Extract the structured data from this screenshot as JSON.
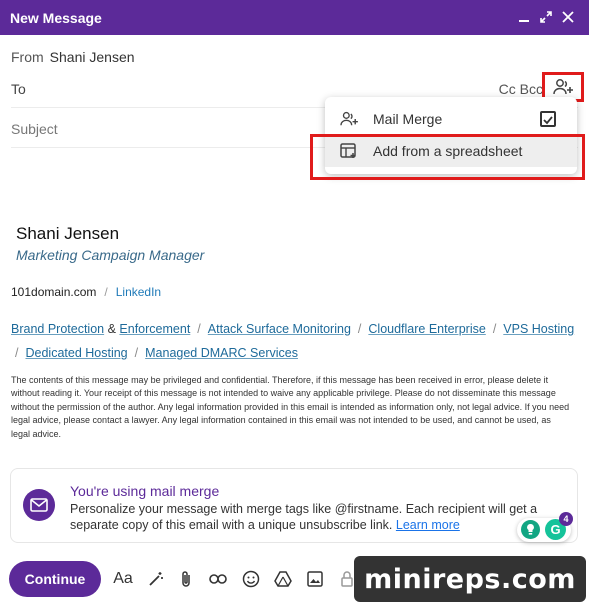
{
  "window": {
    "title": "New Message",
    "controls": [
      "minimize-icon",
      "expand-icon",
      "close-icon"
    ]
  },
  "from": {
    "label": "From",
    "value": "Shani Jensen"
  },
  "to": {
    "label": "To",
    "cc_bcc": "Cc Bcc"
  },
  "subject": {
    "placeholder": "Subject"
  },
  "dropdown": {
    "items": [
      {
        "label": "Mail Merge",
        "icon": "people-add-icon",
        "checked": true
      },
      {
        "label": "Add from a spreadsheet",
        "icon": "spreadsheet-icon"
      }
    ]
  },
  "signature": {
    "name": "Shani Jensen",
    "title": "Marketing Campaign Manager",
    "domain": "101domain.com",
    "separator": "/",
    "linkedin": "LinkedIn",
    "services_line1": [
      "Brand Protection",
      "Enforcement",
      "Attack Surface Monitoring",
      "Cloudflare Enterprise",
      "VPS Hosting"
    ],
    "amp": "&",
    "services_line2": [
      "Dedicated Hosting",
      "Managed DMARC Services"
    ],
    "disclaimer": "The contents of this message may be privileged and confidential. Therefore, if this message has been received in error, please delete it without reading it. Your receipt of this message is not intended to waive any applicable privilege. Please do not disseminate this message without the permission of the author. Any legal information provided in this email is intended as information only, not legal advice. If you need legal advice, please contact a lawyer. Any legal information contained in this email was not intended to be used, and cannot be used, as legal advice."
  },
  "mail_merge_card": {
    "heading": "You're using mail merge",
    "text": "Personalize your message with merge tags like @firstname. Each recipient will get a separate copy of this email with a unique unsubscribe link.",
    "link": "Learn more"
  },
  "grammarly": {
    "badge": "4"
  },
  "toolbar": {
    "continue_label": "Continue",
    "format_label": "Aa"
  },
  "watermark": "minireps.com",
  "colors": {
    "brand": "#5c2a99",
    "highlight": "#e01b1b",
    "link": "#1e6a9a"
  }
}
